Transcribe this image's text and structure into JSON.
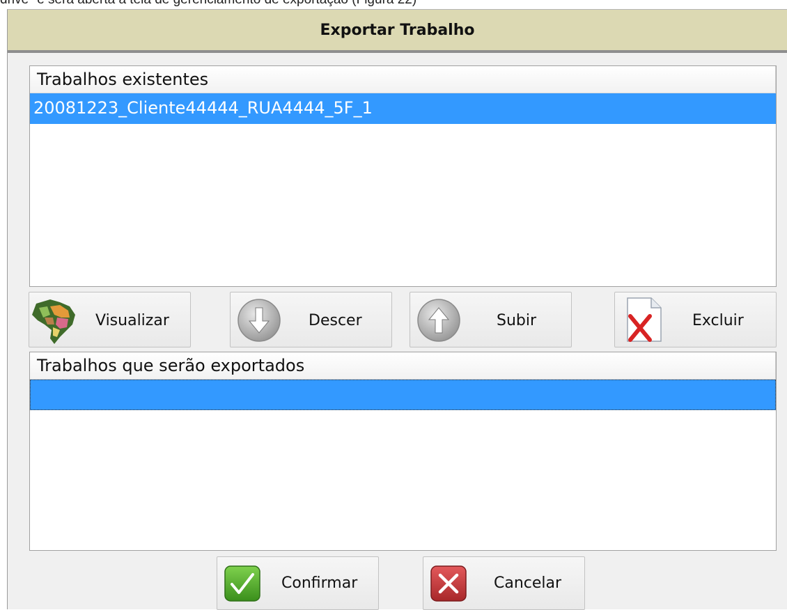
{
  "caption": "drive\" e será aberta a tela de gerenciamento de exportação (Figura 22)",
  "dialog": {
    "title": "Exportar Trabalho"
  },
  "existing_list": {
    "header": "Trabalhos existentes",
    "items": [
      "20081223_Cliente44444_RUA4444_5F_1"
    ]
  },
  "toolbar": {
    "visualizar_label": "Visualizar",
    "descer_label": "Descer",
    "subir_label": "Subir",
    "excluir_label": "Excluir"
  },
  "export_list": {
    "header": "Trabalhos que serão exportados",
    "items": [
      ""
    ]
  },
  "footer": {
    "confirmar_label": "Confirmar",
    "cancelar_label": "Cancelar"
  },
  "colors": {
    "title_bar": "#dcd9b3",
    "selection": "#3399ff",
    "confirm_green": "#4caf2a",
    "cancel_red": "#c0393b"
  }
}
